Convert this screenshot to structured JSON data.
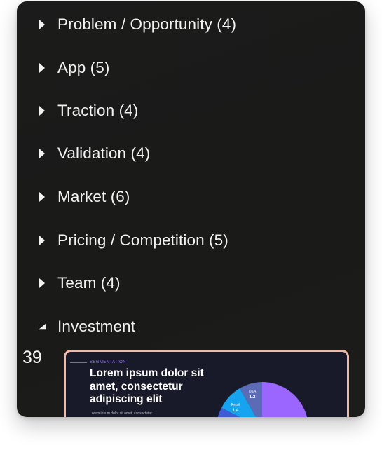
{
  "sections": [
    {
      "label": "Problem / Opportunity (4)",
      "expanded": false
    },
    {
      "label": "App (5)",
      "expanded": false
    },
    {
      "label": "Traction (4)",
      "expanded": false
    },
    {
      "label": "Validation (4)",
      "expanded": false
    },
    {
      "label": "Market (6)",
      "expanded": false
    },
    {
      "label": "Pricing / Competition (5)",
      "expanded": false
    },
    {
      "label": "Team (4)",
      "expanded": false
    },
    {
      "label": "Investment",
      "expanded": true
    }
  ],
  "slide": {
    "number": "39",
    "kicker": "SEGMENTATION",
    "title": "Lorem ipsum dolor sit amet, consectetur adipiscing elit",
    "subtitle": "Lorem ipsum dolor sit amet, consectetur",
    "chart": {
      "slices": [
        {
          "label": "Q&A",
          "value": "1.2",
          "color": "#5b6bb5"
        },
        {
          "label": "Retail",
          "value": "1.4",
          "color": "#14a4f0"
        }
      ],
      "accent_colors": [
        "#9b66ff",
        "#3f5bd6"
      ]
    }
  },
  "colors": {
    "panel_bg": "#1b1b1b",
    "text": "#f2f2f2",
    "thumb_border": "#f4b7a1",
    "thumb_bg": "#181a29"
  }
}
